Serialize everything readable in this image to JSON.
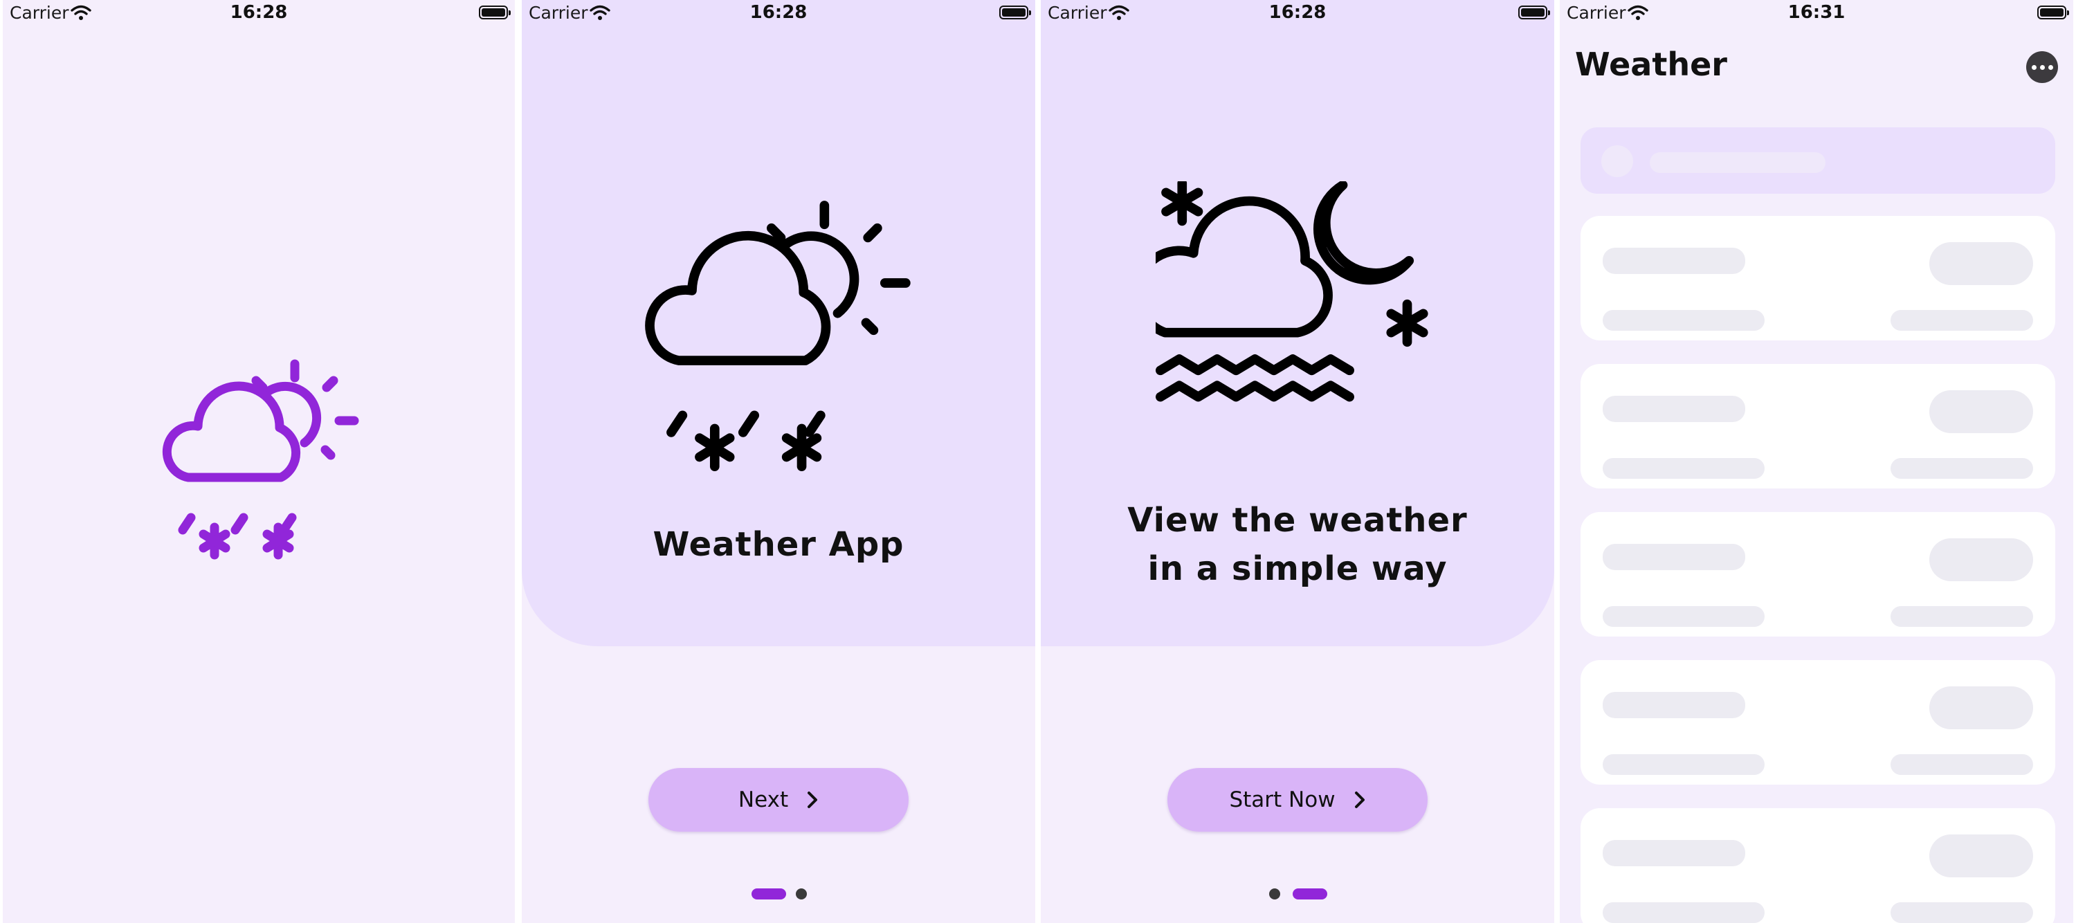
{
  "status_bars": [
    {
      "carrier": "Carrier",
      "time": "16:28"
    },
    {
      "carrier": "Carrier",
      "time": "16:28"
    },
    {
      "carrier": "Carrier",
      "time": "16:28"
    },
    {
      "carrier": "Carrier",
      "time": "16:31"
    }
  ],
  "splash": {
    "icon": "cloud-sun-snow-icon",
    "icon_color": "#9126d9"
  },
  "onboarding_1": {
    "icon": "cloud-sun-snow-icon",
    "title": "Weather App",
    "button_label": "Next",
    "button_icon": "chevron-right-icon",
    "page_index": 0,
    "page_count": 2
  },
  "onboarding_2": {
    "icon": "cloud-moon-fog-snow-icon",
    "title": "View the weather\nin a simple way",
    "button_label": "Start Now",
    "button_icon": "chevron-right-icon",
    "page_index": 1,
    "page_count": 2
  },
  "weather": {
    "title": "Weather",
    "menu_icon": "more-horizontal-icon",
    "loading_cards": 5
  },
  "colors": {
    "accent": "#9126d9",
    "panel": "#eadffd",
    "background": "#f5eefc",
    "button": "#d9b4f8",
    "skeleton": "#ecebf2"
  }
}
